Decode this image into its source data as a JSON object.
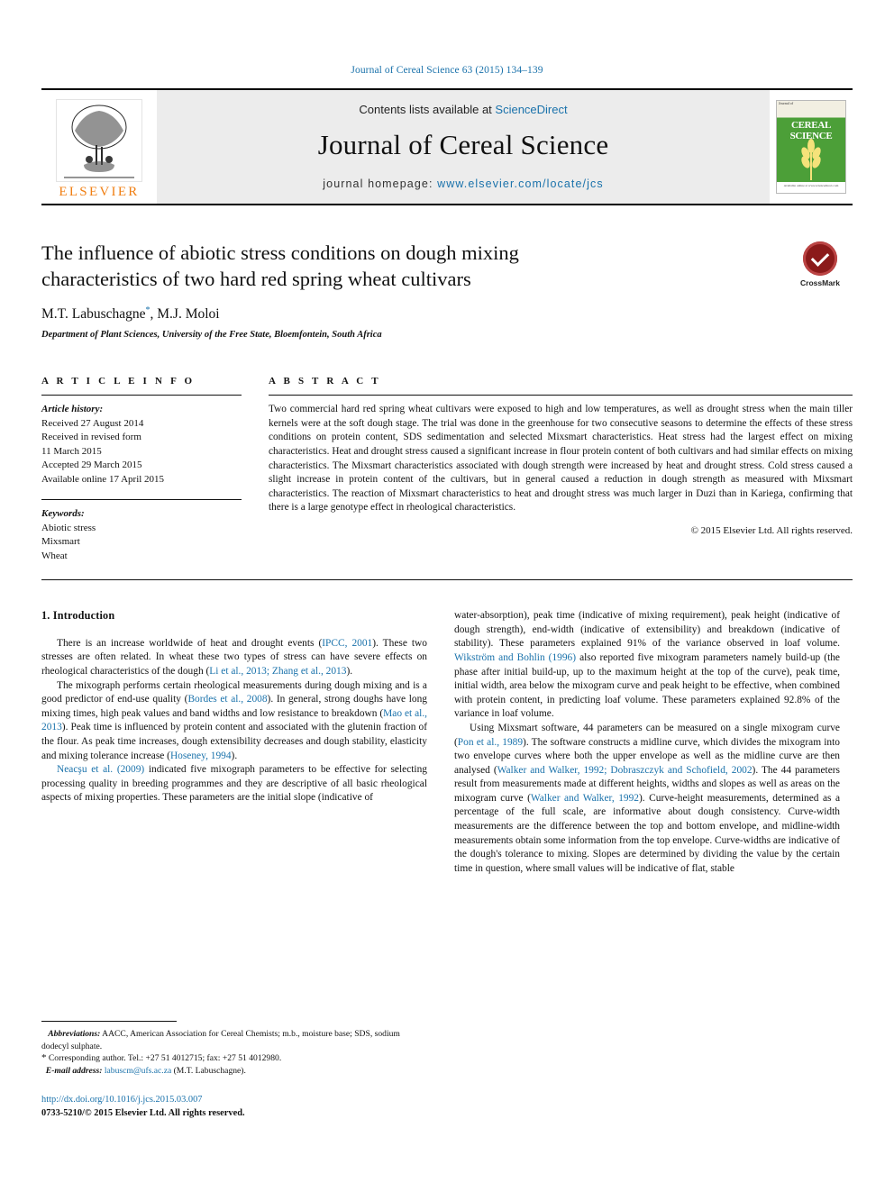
{
  "running_head": "Journal of Cereal Science 63 (2015) 134–139",
  "masthead": {
    "contents_prefix": "Contents lists available at ",
    "sciencedirect": "ScienceDirect",
    "journal_name": "Journal of Cereal Science",
    "homepage_prefix": "journal homepage: ",
    "homepage_url": "www.elsevier.com/locate/jcs",
    "publisher": "ELSEVIER",
    "cover": {
      "line1": "Journal of",
      "title1": "CEREAL",
      "title2": "SCIENCE",
      "footer": "Available online at www.sciencedirect.com"
    }
  },
  "article": {
    "title": "The influence of abiotic stress conditions on dough mixing characteristics of two hard red spring wheat cultivars",
    "authors": "M.T. Labuschagne",
    "authors_rest": ", M.J. Moloi",
    "corresponding_marker": "*",
    "affiliation": "Department of Plant Sciences, University of the Free State, Bloemfontein, South Africa",
    "crossmark_label": "CrossMark"
  },
  "article_info": {
    "heading": "A R T I C L E   I N F O",
    "history_label": "Article history:",
    "history": [
      "Received 27 August 2014",
      "Received in revised form",
      "11 March 2015",
      "Accepted 29 March 2015",
      "Available online 17 April 2015"
    ],
    "keywords_label": "Keywords:",
    "keywords": [
      "Abiotic stress",
      "Mixsmart",
      "Wheat"
    ]
  },
  "abstract": {
    "heading": "A B S T R A C T",
    "text": "Two commercial hard red spring wheat cultivars were exposed to high and low temperatures, as well as drought stress when the main tiller kernels were at the soft dough stage. The trial was done in the greenhouse for two consecutive seasons to determine the effects of these stress conditions on protein content, SDS sedimentation and selected Mixsmart characteristics. Heat stress had the largest effect on mixing characteristics. Heat and drought stress caused a significant increase in flour protein content of both cultivars and had similar effects on mixing characteristics. The Mixsmart characteristics associated with dough strength were increased by heat and drought stress. Cold stress caused a slight increase in protein content of the cultivars, but in general caused a reduction in dough strength as measured with Mixsmart characteristics. The reaction of Mixsmart characteristics to heat and drought stress was much larger in Duzi than in Kariega, confirming that there is a large genotype effect in rheological characteristics.",
    "copyright": "© 2015 Elsevier Ltd. All rights reserved."
  },
  "introduction": {
    "section_number_title": "1. Introduction",
    "left_paragraphs": [
      {
        "parts": [
          {
            "t": "There is an increase worldwide of heat and drought events ("
          },
          {
            "t": "IPCC, 2001",
            "cite": true
          },
          {
            "t": "). These two stresses are often related. In wheat these two types of stress can have severe effects on rheological characteristics of the dough ("
          },
          {
            "t": "Li et al., 2013; Zhang et al., 2013",
            "cite": true
          },
          {
            "t": ")."
          }
        ]
      },
      {
        "parts": [
          {
            "t": "The mixograph performs certain rheological measurements during dough mixing and is a good predictor of end-use quality ("
          },
          {
            "t": "Bordes et al., 2008",
            "cite": true
          },
          {
            "t": "). In general, strong doughs have long mixing times, high peak values and band widths and low resistance to breakdown ("
          },
          {
            "t": "Mao et al., 2013",
            "cite": true
          },
          {
            "t": "). Peak time is influenced by protein content and associated with the glutenin fraction of the flour. As peak time increases, dough extensibility decreases and dough stability, elasticity and mixing tolerance increase ("
          },
          {
            "t": "Hoseney, 1994",
            "cite": true
          },
          {
            "t": ")."
          }
        ]
      },
      {
        "parts": [
          {
            "t": "Neacşu et al. (2009)",
            "cite": true
          },
          {
            "t": " indicated five mixograph parameters to be effective for selecting processing quality in breeding programmes and they are descriptive of all basic rheological aspects of mixing properties. These parameters are the initial slope (indicative of"
          }
        ]
      }
    ],
    "right_paragraphs": [
      {
        "parts": [
          {
            "t": "water-absorption), peak time (indicative of mixing requirement), peak height (indicative of dough strength), end-width (indicative of extensibility) and breakdown (indicative of stability). These parameters explained 91% of the variance observed in loaf volume. "
          },
          {
            "t": "Wikström and Bohlin (1996)",
            "cite": true
          },
          {
            "t": " also reported five mixogram parameters namely build-up (the phase after initial build-up, up to the maximum height at the top of the curve), peak time, initial width, area below the mixogram curve and peak height to be effective, when combined with protein content, in predicting loaf volume. These parameters explained 92.8% of the variance in loaf volume."
          }
        ],
        "noindent": true
      },
      {
        "parts": [
          {
            "t": "Using Mixsmart software, 44 parameters can be measured on a single mixogram curve ("
          },
          {
            "t": "Pon et al., 1989",
            "cite": true
          },
          {
            "t": "). The software constructs a midline curve, which divides the mixogram into two envelope curves where both the upper envelope as well as the midline curve are then analysed ("
          },
          {
            "t": "Walker and Walker, 1992; Dobraszczyk and Schofield, 2002",
            "cite": true
          },
          {
            "t": "). The 44 parameters result from measurements made at different heights, widths and slopes as well as areas on the mixogram curve ("
          },
          {
            "t": "Walker and Walker, 1992",
            "cite": true
          },
          {
            "t": "). Curve-height measurements, determined as a percentage of the full scale, are informative about dough consistency. Curve-width measurements are the difference between the top and bottom envelope, and midline-width measurements obtain some information from the top envelope. Curve-widths are indicative of the dough's tolerance to mixing. Slopes are determined by dividing the value by the certain time in question, where small values will be indicative of flat, stable"
          }
        ]
      }
    ]
  },
  "footnotes": {
    "abbreviations_label": "Abbreviations:",
    "abbreviations_text": " AACC, American Association for Cereal Chemists; m.b., moisture base; SDS, sodium dodecyl sulphate.",
    "corresponding_marker": "*",
    "corresponding_text": " Corresponding author. Tel.: +27 51 4012715; fax: +27 51 4012980.",
    "email_label": "E-mail address:",
    "email": "labuscm@ufs.ac.za",
    "email_suffix": " (M.T. Labuschagne)."
  },
  "footer": {
    "doi": "http://dx.doi.org/10.1016/j.jcs.2015.03.007",
    "issn_line": "0733-5210/© 2015 Elsevier Ltd. All rights reserved."
  },
  "colors": {
    "link": "#1a72ab",
    "elsevier_orange": "#f07f13",
    "masthead_bg": "#ececec",
    "cover_green": "#4c9f38"
  }
}
